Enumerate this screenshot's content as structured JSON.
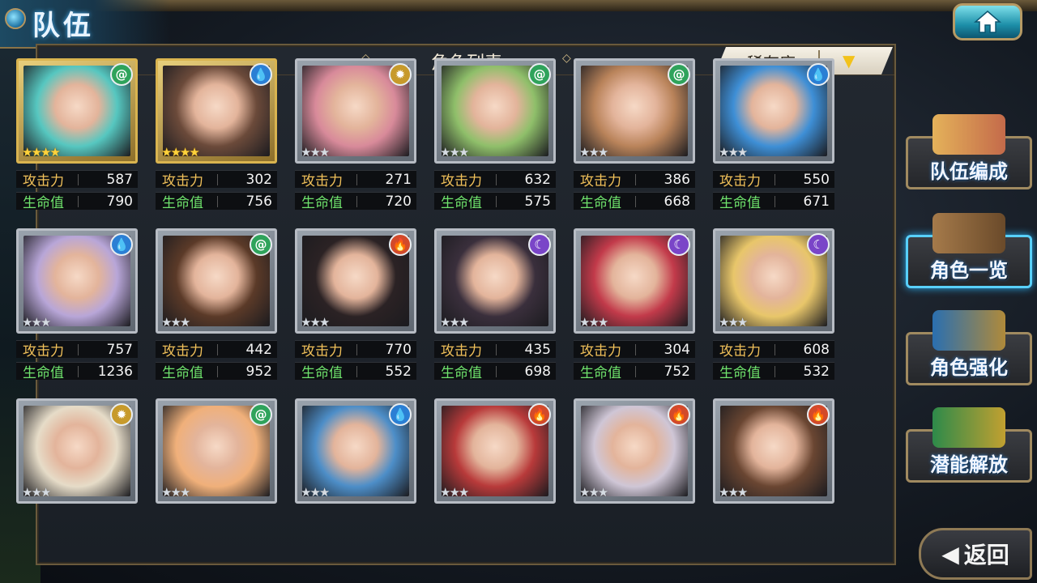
{
  "screen": {
    "title": "队伍",
    "panel_title": "角色列表",
    "sort": {
      "label": "稀有度"
    }
  },
  "labels": {
    "atk": "攻击力",
    "hp": "生命值"
  },
  "element_colors": {
    "wind": "#2fa35b",
    "water": "#2b7fd4",
    "light": "#c79a2b",
    "fire": "#d24a2a",
    "dark": "#7a45c8"
  },
  "characters": [
    {
      "element": "wind",
      "stars": 4,
      "rarity": "gold",
      "atk": "587",
      "hp": "790"
    },
    {
      "element": "water",
      "stars": 4,
      "rarity": "gold",
      "atk": "302",
      "hp": "756"
    },
    {
      "element": "light",
      "stars": 3,
      "rarity": "silver",
      "atk": "271",
      "hp": "720"
    },
    {
      "element": "wind",
      "stars": 3,
      "rarity": "silver",
      "atk": "632",
      "hp": "575"
    },
    {
      "element": "wind",
      "stars": 3,
      "rarity": "silver",
      "atk": "386",
      "hp": "668"
    },
    {
      "element": "water",
      "stars": 3,
      "rarity": "silver",
      "atk": "550",
      "hp": "671"
    },
    {
      "element": "water",
      "stars": 3,
      "rarity": "silver",
      "atk": "757",
      "hp": "1236"
    },
    {
      "element": "wind",
      "stars": 3,
      "rarity": "silver",
      "atk": "442",
      "hp": "952"
    },
    {
      "element": "fire",
      "stars": 3,
      "rarity": "silver",
      "atk": "770",
      "hp": "552"
    },
    {
      "element": "dark",
      "stars": 3,
      "rarity": "silver",
      "atk": "435",
      "hp": "698"
    },
    {
      "element": "dark",
      "stars": 3,
      "rarity": "silver",
      "atk": "304",
      "hp": "752"
    },
    {
      "element": "dark",
      "stars": 3,
      "rarity": "silver",
      "atk": "608",
      "hp": "532"
    },
    {
      "element": "light",
      "stars": 3,
      "rarity": "silver"
    },
    {
      "element": "wind",
      "stars": 3,
      "rarity": "silver"
    },
    {
      "element": "water",
      "stars": 3,
      "rarity": "silver"
    },
    {
      "element": "fire",
      "stars": 3,
      "rarity": "silver"
    },
    {
      "element": "fire",
      "stars": 3,
      "rarity": "silver"
    },
    {
      "element": "fire",
      "stars": 3,
      "rarity": "silver"
    }
  ],
  "sidebar": {
    "items": [
      {
        "label": "队伍编成",
        "active": false,
        "icon": "team-icon"
      },
      {
        "label": "角色一览",
        "active": true,
        "icon": "book-icon"
      },
      {
        "label": "角色强化",
        "active": false,
        "icon": "enhance-icon"
      },
      {
        "label": "潜能解放",
        "active": false,
        "icon": "potential-icon"
      }
    ]
  },
  "back": {
    "label": "返回"
  }
}
